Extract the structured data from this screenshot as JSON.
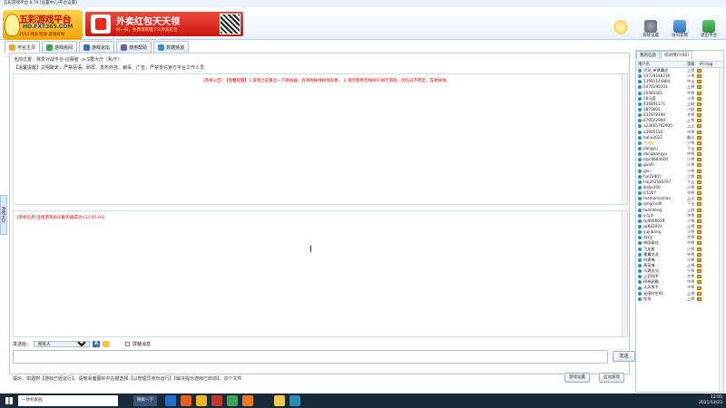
{
  "window": {
    "title": "五彩游戏平台 8.79 [设置中心/平台设置]"
  },
  "logo": {
    "brand": "五彩游戏平台",
    "site": "HD.FXT365.COM",
    "slogan": "2013 精彩无限 游戏有你"
  },
  "banner": {
    "headline": "外卖红包天天领",
    "subline": "扫一扫，免费领取饿了么外卖红包"
  },
  "toolbar": {
    "settings_label": "系统设置",
    "homepage_label": "访问官网",
    "exit_label": "退出平台"
  },
  "tabs": [
    {
      "label": "平台主页",
      "color": "#e9a23b"
    },
    {
      "label": "游戏房间",
      "color": "#3aa655"
    },
    {
      "label": "游戏论坛",
      "color": "#3b6fb6"
    },
    {
      "label": "使用帮助",
      "color": "#6b5bb0"
    },
    {
      "label": "数据频道",
      "color": "#3b8fc9"
    }
  ],
  "main": {
    "location": "当前位置：我爱对战平台-征服者 -> 5群大厅（私厅）",
    "notice": "【温馨提醒】文明聊天，严禁恶语、刷屏、发布外挂、病毒、广告，严禁冒充官方平台工作人员",
    "system_message": "[系统公告] 【温馨提醒】1.游戏之前重启一下路由器，有效防掉线掉等现象。    2.请勿使用无线WIFI进行游戏，因信号不稳定，容易掉线。",
    "log_message": "[系统信息]连接游戏房间服务器成功!(12:05:01)",
    "vertical_tab": "游戏大厅"
  },
  "send": {
    "to_label": "发送给：",
    "to_value": "所有人",
    "bold_label": "A",
    "mute_label": "屏蔽消息",
    "button": "发送"
  },
  "hint": "提示：如遇到【游戏已经运行】，请到桌面图标中右键选择【以管理员身份运行】【解决提示游戏已启动】，这个文件",
  "bottom_buttons": {
    "settings": "游戏设置",
    "start": "启动游戏"
  },
  "side": {
    "tabs": [
      "我的信息",
      "房间用户(42)"
    ],
    "headers": [
      "用户名",
      "等级",
      "IP-Flag"
    ],
    "users": [
      {
        "name": "大风_单票翼虎",
        "level": "上将"
      },
      {
        "name": "13729188730",
        "level": "少将"
      },
      {
        "name": "13991144884",
        "level": "中士"
      },
      {
        "name": "2470290201",
        "level": "上将"
      },
      {
        "name": "25403301",
        "level": "中将"
      },
      {
        "name": "26马度",
        "level": "少将"
      },
      {
        "name": "435891171",
        "level": "上尉"
      },
      {
        "name": "5870605",
        "level": "少尉"
      },
      {
        "name": "632978396",
        "level": "大将"
      },
      {
        "name": "670022900",
        "level": "上将"
      },
      {
        "name": "a23665782905",
        "level": "上士"
      },
      {
        "name": "a3945150",
        "level": "中将"
      },
      {
        "name": "buliu2022",
        "level": "翻兵"
      },
      {
        "name": "大地区",
        "level": "少将"
      },
      {
        "name": "dangyu",
        "level": "下士"
      },
      {
        "name": "dongbangyu",
        "level": "中将"
      },
      {
        "name": "djyc0683604",
        "level": "少将"
      },
      {
        "name": "guofli",
        "level": "少将"
      },
      {
        "name": "gxn",
        "level": "少将"
      },
      {
        "name": "hai22807",
        "level": "少将"
      },
      {
        "name": "hai2025SS767",
        "level": "下士"
      },
      {
        "name": "lbsbs200",
        "level": "少将"
      },
      {
        "name": "lc1207",
        "level": "中将"
      },
      {
        "name": "mamamoshov",
        "level": "上士"
      },
      {
        "name": "qingl1sd0",
        "level": "下士"
      },
      {
        "name": "tuandong",
        "level": "上尉"
      },
      {
        "name": "yi1jlh",
        "level": "中将"
      },
      {
        "name": "wj9966039",
        "level": "少将"
      },
      {
        "name": "wj881003",
        "level": "上将"
      },
      {
        "name": "yujlibang",
        "level": "少将"
      },
      {
        "name": "zzzjy",
        "level": "大将"
      },
      {
        "name": "帝国泰炫",
        "level": "中将"
      },
      {
        "name": "飞龙星",
        "level": "少将"
      },
      {
        "name": "毫翼龙龙",
        "level": "中将"
      },
      {
        "name": "何建锋",
        "level": "少将"
      },
      {
        "name": "黄英锋",
        "level": "上将"
      },
      {
        "name": "马建龙马",
        "level": "少将"
      },
      {
        "name": "上官606",
        "level": "大将"
      },
      {
        "name": "四帝副霸",
        "level": "中将"
      },
      {
        "name": "天风杀手",
        "level": "中将"
      },
      {
        "name": "无限时空91",
        "level": "上将"
      },
      {
        "name": "在线",
        "level": "上将"
      }
    ]
  },
  "taskbar": {
    "search_placeholder": "一体机家园",
    "task_label": "搜索一下",
    "time": "12:05",
    "date": "2021/12/23"
  }
}
